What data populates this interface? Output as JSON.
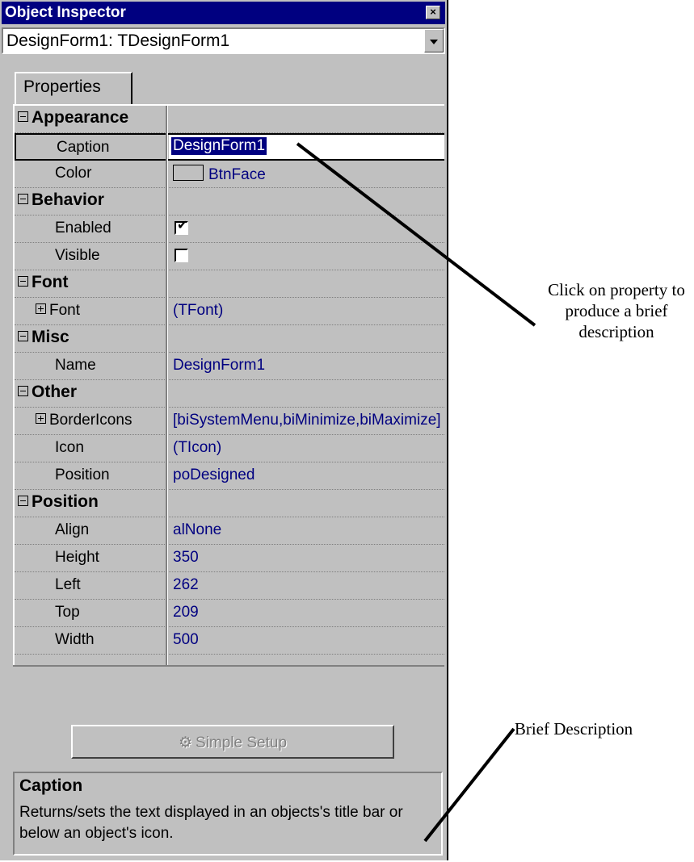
{
  "window": {
    "title": "Object Inspector"
  },
  "object_selector": {
    "value": "DesignForm1: TDesignForm1"
  },
  "tabs": [
    {
      "label": "Properties"
    }
  ],
  "categories": {
    "appearance": "Appearance",
    "behavior": "Behavior",
    "font": "Font",
    "misc": "Misc",
    "other": "Other",
    "position": "Position"
  },
  "properties": {
    "caption": {
      "name": "Caption",
      "value": "DesignForm1"
    },
    "color": {
      "name": "Color",
      "value": "BtnFace"
    },
    "enabled": {
      "name": "Enabled",
      "checked": true
    },
    "visible": {
      "name": "Visible",
      "checked": false
    },
    "font": {
      "name": "Font",
      "value": "(TFont)"
    },
    "name": {
      "name": "Name",
      "value": "DesignForm1"
    },
    "bordericons": {
      "name": "BorderIcons",
      "value": "[biSystemMenu,biMinimize,biMaximize]"
    },
    "icon": {
      "name": "Icon",
      "value": "(TIcon)"
    },
    "position": {
      "name": "Position",
      "value": "poDesigned"
    },
    "align": {
      "name": "Align",
      "value": "alNone"
    },
    "height": {
      "name": "Height",
      "value": "350"
    },
    "left": {
      "name": "Left",
      "value": "262"
    },
    "top": {
      "name": "Top",
      "value": "209"
    },
    "width": {
      "name": "Width",
      "value": "500"
    }
  },
  "setup_button": {
    "label": "Simple Setup",
    "enabled": false
  },
  "description": {
    "title": "Caption",
    "text": "Returns/sets the text displayed in an objects's title bar or below an object's icon."
  },
  "annotations": {
    "click_note": "Click on property to produce a brief description",
    "brief_note": "Brief Description"
  },
  "colors": {
    "titlebar": "#000080",
    "face": "#c0c0c0",
    "value_text": "#000080"
  }
}
